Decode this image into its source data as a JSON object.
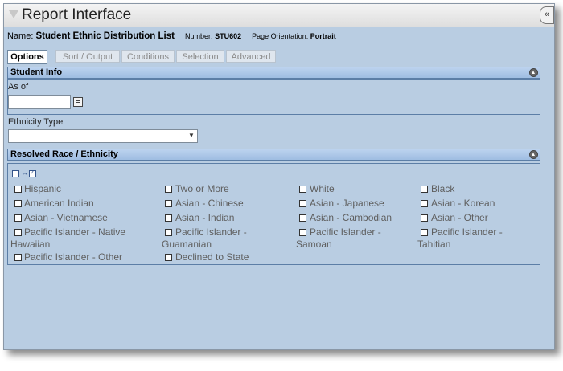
{
  "window": {
    "title": "Report Interface",
    "collapse_glyph": "«"
  },
  "report": {
    "name_label": "Name:",
    "name": "Student Ethnic Distribution List",
    "number_label": "Number:",
    "number": "STU602",
    "orientation_label": "Page Orientation:",
    "orientation": "Portrait"
  },
  "tabs": [
    {
      "label": "Options",
      "active": true
    },
    {
      "label": "Sort / Output",
      "active": false
    },
    {
      "label": "Conditions",
      "active": false
    },
    {
      "label": "Selection",
      "active": false
    },
    {
      "label": "Advanced",
      "active": false
    }
  ],
  "student_info": {
    "title": "Student Info",
    "as_of_label": "As of",
    "as_of_value": "",
    "ethnicity_label": "Ethnicity Type",
    "ethnicity_value": ""
  },
  "race": {
    "title": "Resolved Race / Ethnicity",
    "checkboxes": [
      {
        "label": "Hispanic"
      },
      {
        "label": "Two or More"
      },
      {
        "label": "White"
      },
      {
        "label": "Black"
      },
      {
        "label": "American Indian"
      },
      {
        "label": "Asian - Chinese"
      },
      {
        "label": "Asian - Japanese"
      },
      {
        "label": "Asian - Korean"
      },
      {
        "label": "Asian - Vietnamese"
      },
      {
        "label": "Asian - Indian"
      },
      {
        "label": "Asian - Cambodian"
      },
      {
        "label": "Asian - Other"
      },
      {
        "label_line1": "Pacific Islander - Native",
        "label_line2": "Hawaiian"
      },
      {
        "label_line1": "Pacific Islander -",
        "label_line2": "Guamanian"
      },
      {
        "label_line1": "Pacific Islander -",
        "label_line2": "Samoan"
      },
      {
        "label_line1": "Pacific Islander -",
        "label_line2": "Tahitian"
      },
      {
        "label": "Pacific Islander - Other"
      },
      {
        "label": "Declined to State"
      }
    ]
  },
  "colors": {
    "background": "#b9cde2",
    "section_header": "#a8c4e6",
    "border": "#5c7ea6"
  }
}
